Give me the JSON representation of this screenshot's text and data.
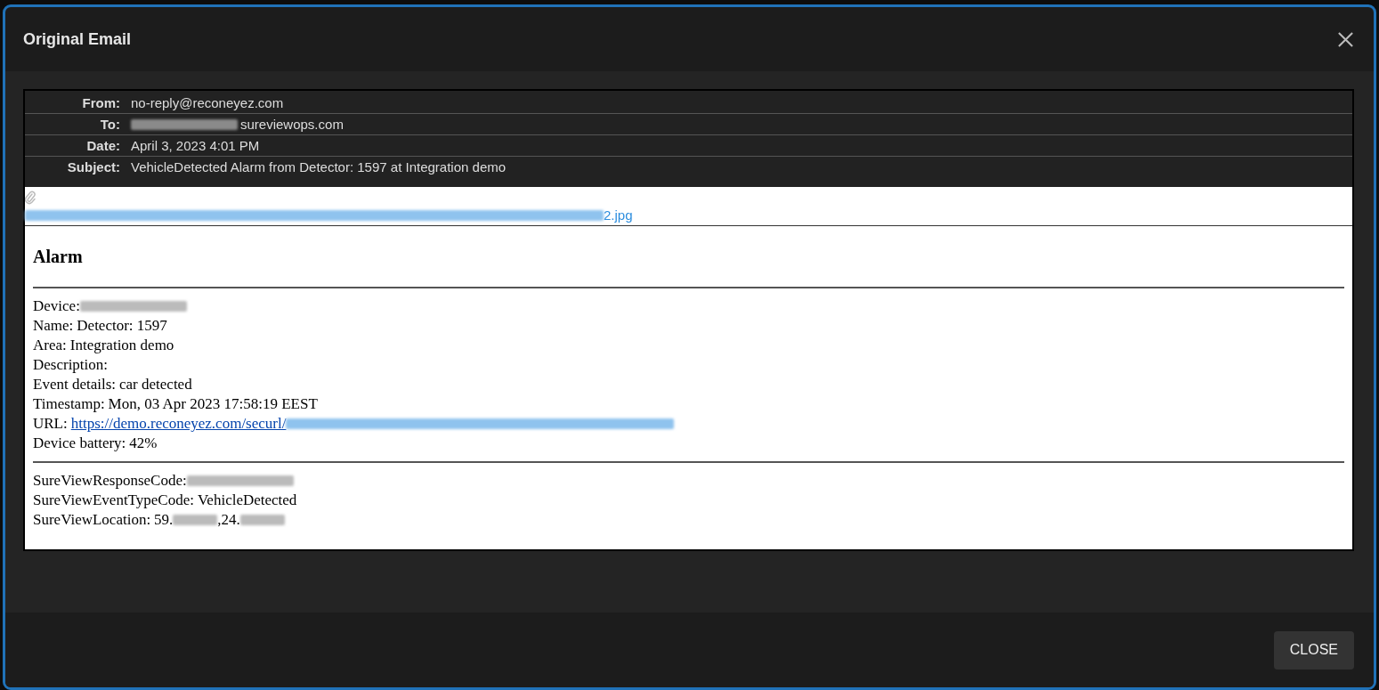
{
  "dialog": {
    "title": "Original Email",
    "close_button": "CLOSE"
  },
  "headers": [
    {
      "label": "From:",
      "parts": [
        {
          "kind": "text",
          "text": "no-reply@reconeyez.com"
        }
      ]
    },
    {
      "label": "To:",
      "parts": [
        {
          "kind": "redacted"
        },
        {
          "kind": "text",
          "text": "sureviewops.com"
        }
      ]
    },
    {
      "label": "Date:",
      "parts": [
        {
          "kind": "text",
          "text": "April 3, 2023 4:01 PM"
        }
      ]
    },
    {
      "label": "Subject:",
      "parts": [
        {
          "kind": "text",
          "text": "VehicleDetected Alarm from Detector: 1597 at Integration demo"
        }
      ]
    }
  ],
  "attachment": {
    "parts": [
      {
        "kind": "fileblur"
      },
      {
        "kind": "text",
        "text": "2.jpg"
      }
    ]
  },
  "body": {
    "heading": "Alarm",
    "sections": [
      [
        {
          "label": "Device:",
          "parts": [
            {
              "kind": "redacted"
            }
          ]
        },
        {
          "label": "Name:",
          "parts": [
            {
              "kind": "text",
              "text": "Detector: 1597"
            }
          ]
        },
        {
          "label": "Area:",
          "parts": [
            {
              "kind": "text",
              "text": "Integration demo"
            }
          ]
        },
        {
          "label": "Description:"
        },
        {
          "label": "Event details:",
          "parts": [
            {
              "kind": "text",
              "text": "car detected"
            }
          ]
        },
        {
          "label": "Timestamp:",
          "parts": [
            {
              "kind": "text",
              "text": "Mon, 03 Apr 2023 17:58:19 EEST"
            }
          ]
        },
        {
          "label": "URL:",
          "parts": [
            {
              "kind": "link",
              "text": "https://demo.reconeyez.com/securl/"
            },
            {
              "kind": "linkblur"
            }
          ]
        },
        {
          "label": "Device battery:",
          "parts": [
            {
              "kind": "text",
              "text": "42%"
            }
          ]
        }
      ],
      [
        {
          "label": "SureViewResponseCode:",
          "parts": [
            {
              "kind": "redacted"
            }
          ]
        },
        {
          "label": "SureViewEventTypeCode:",
          "parts": [
            {
              "kind": "text",
              "text": "VehicleDetected"
            }
          ]
        },
        {
          "label": "SureViewLocation:",
          "parts": [
            {
              "kind": "text",
              "text": "59."
            },
            {
              "kind": "snippet"
            },
            {
              "kind": "text",
              "text": ",24."
            },
            {
              "kind": "snippet"
            }
          ]
        }
      ]
    ]
  }
}
